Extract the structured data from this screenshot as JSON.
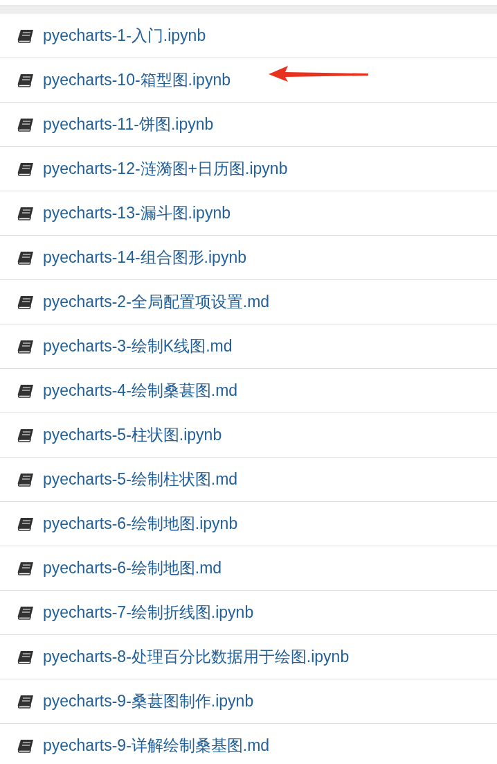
{
  "files": [
    {
      "name": "pyecharts-1-入门.ipynb",
      "pointed_at": false
    },
    {
      "name": "pyecharts-10-箱型图.ipynb",
      "pointed_at": true
    },
    {
      "name": "pyecharts-11-饼图.ipynb",
      "pointed_at": false
    },
    {
      "name": "pyecharts-12-涟漪图+日历图.ipynb",
      "pointed_at": false
    },
    {
      "name": "pyecharts-13-漏斗图.ipynb",
      "pointed_at": false
    },
    {
      "name": "pyecharts-14-组合图形.ipynb",
      "pointed_at": false
    },
    {
      "name": "pyecharts-2-全局配置项设置.md",
      "pointed_at": false
    },
    {
      "name": "pyecharts-3-绘制K线图.md",
      "pointed_at": false
    },
    {
      "name": "pyecharts-4-绘制桑葚图.md",
      "pointed_at": false
    },
    {
      "name": "pyecharts-5-柱状图.ipynb",
      "pointed_at": false
    },
    {
      "name": "pyecharts-5-绘制柱状图.md",
      "pointed_at": false
    },
    {
      "name": "pyecharts-6-绘制地图.ipynb",
      "pointed_at": false
    },
    {
      "name": "pyecharts-6-绘制地图.md",
      "pointed_at": false
    },
    {
      "name": "pyecharts-7-绘制折线图.ipynb",
      "pointed_at": false
    },
    {
      "name": "pyecharts-8-处理百分比数据用于绘图.ipynb",
      "pointed_at": false
    },
    {
      "name": "pyecharts-9-桑葚图制作.ipynb",
      "pointed_at": false
    },
    {
      "name": "pyecharts-9-详解绘制桑基图.md",
      "pointed_at": false
    }
  ]
}
